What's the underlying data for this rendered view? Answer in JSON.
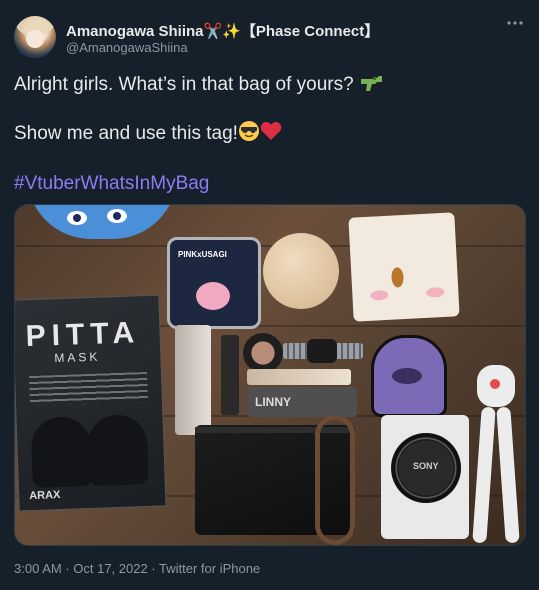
{
  "author": {
    "name": "Amanogawa Shiina",
    "name_emoji": "✂️✨",
    "affiliation": "【Phase Connect】",
    "handle": "@AmanogawaShiina"
  },
  "tweet": {
    "line1": "Alright girls. What’s in that bag of yours?",
    "line1_emoji": "🔫",
    "line2": "Show me and use this tag!",
    "line2_emoji": "😎❤️",
    "hashtag": "#VtuberWhatsInMyBag"
  },
  "media": {
    "mask_brand": "PITTA",
    "mask_sub": "MASK",
    "mask_maker": "ARAX",
    "mirror_text": "PINKxUSAGI",
    "wallet_text": "LINNY",
    "camera_brand": "SONY",
    "icons": [
      "water-gun-icon",
      "cool-face-icon",
      "red-heart-icon",
      "more-icon"
    ]
  },
  "meta": {
    "timestamp": "3:00 AM · Oct 17, 2022 · Twitter for iPhone"
  },
  "colors": {
    "background": "#15202b",
    "text": "#e7e9ea",
    "muted": "#8b98a5",
    "hashtag": "#8b7cf6"
  }
}
